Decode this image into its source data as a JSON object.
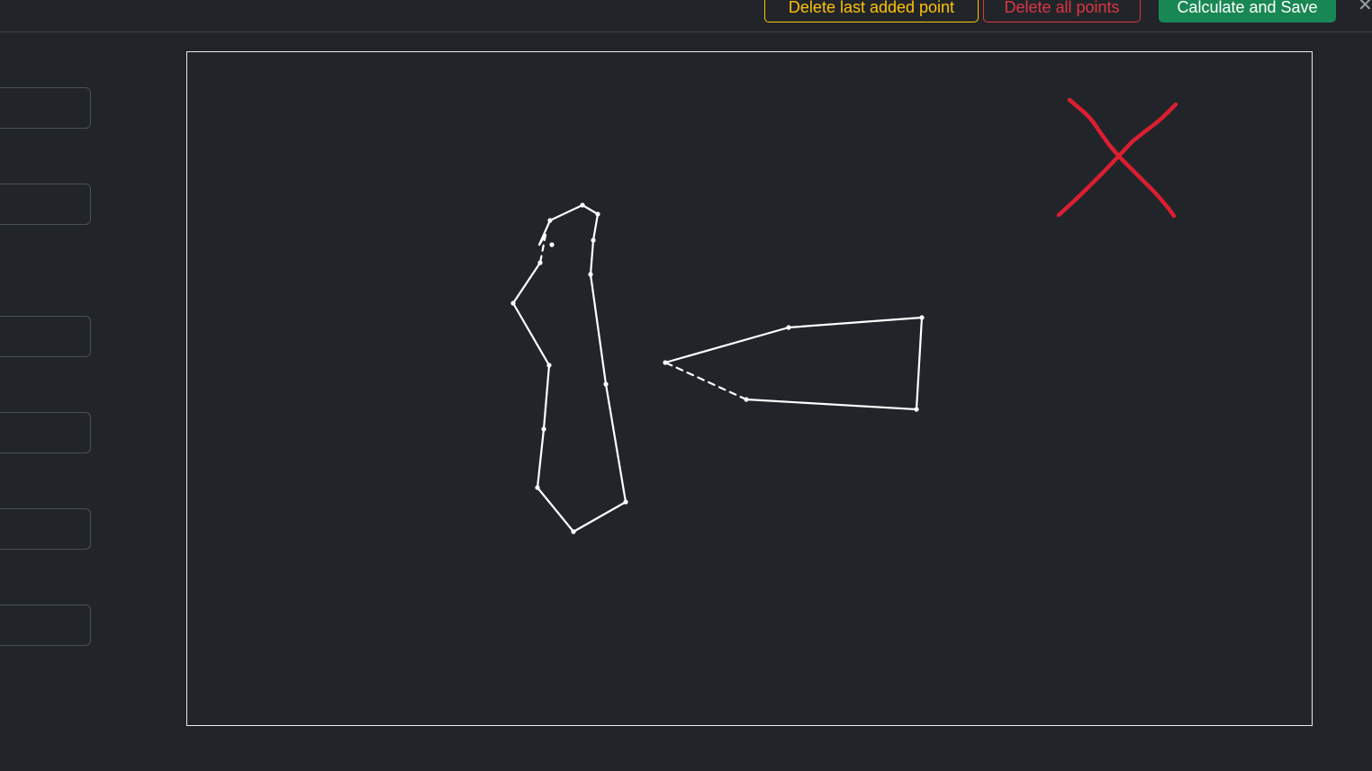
{
  "toolbar": {
    "delete_last_label": "Delete last added point",
    "delete_all_label": "Delete all points",
    "calculate_save_label": "Calculate and Save",
    "close_glyph": "✕"
  },
  "sidebar": {
    "fields": [
      {
        "value": ""
      },
      {
        "value": ""
      },
      {
        "value": ""
      },
      {
        "value": ""
      },
      {
        "value": ""
      },
      {
        "value": ""
      }
    ]
  },
  "canvas": {
    "stroke_color": "#ffffff",
    "mark_color": "#dc1e32",
    "mark_icon": "red-x-mark-icon"
  },
  "colors": {
    "background": "#212529",
    "warning": "#ffc107",
    "danger": "#dc3545",
    "success": "#198754"
  }
}
